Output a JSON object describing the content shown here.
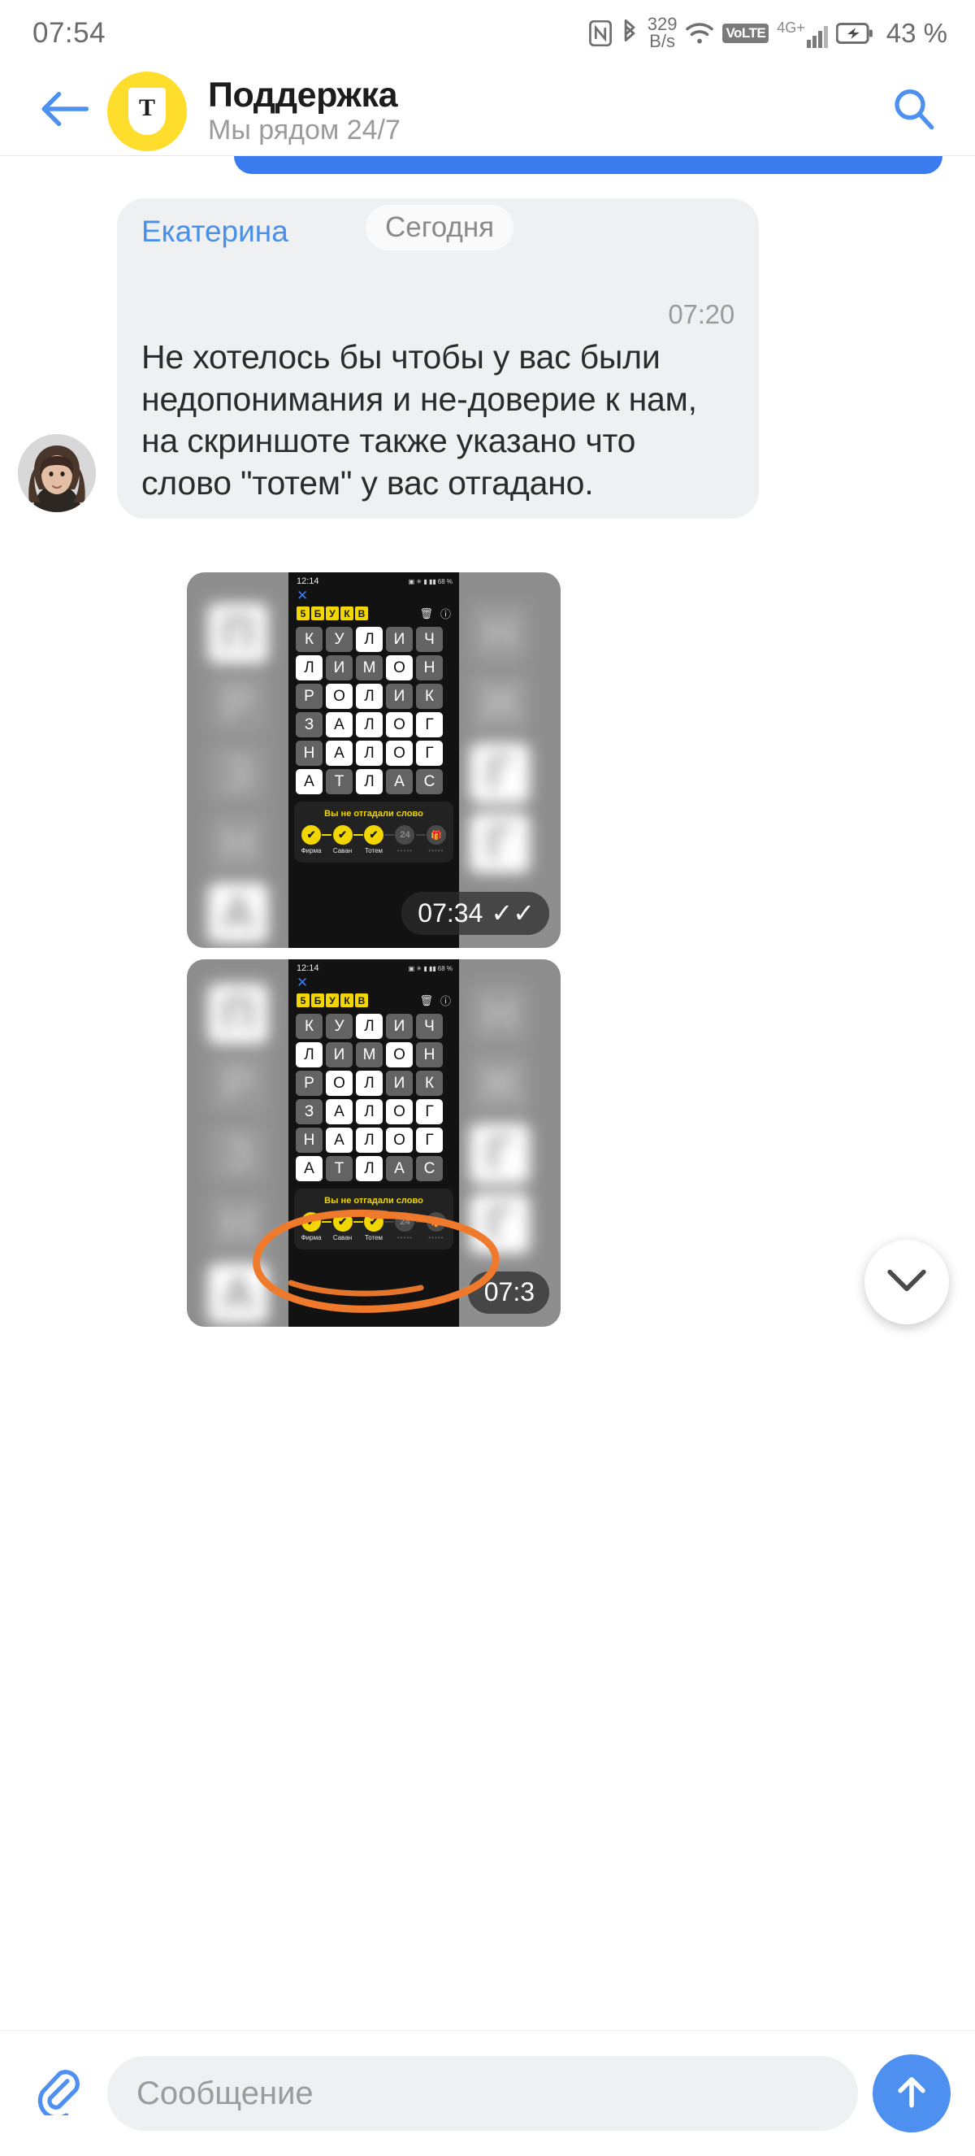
{
  "statusbar": {
    "clock": "07:54",
    "nfc_icon": "nfc-icon",
    "bluetooth_icon": "bluetooth-icon",
    "netspeed_value": "329",
    "netspeed_unit": "B/s",
    "wifi_icon": "wifi-icon",
    "volte_label": "VoLTE",
    "network_label": "4G+",
    "battery_icon": "battery-charging-icon",
    "battery_percent": "43 %"
  },
  "header": {
    "back_icon": "back-arrow-icon",
    "brand_letter": "T",
    "title": "Поддержка",
    "subtitle": "Мы рядом 24/7",
    "search_icon": "search-icon"
  },
  "chat": {
    "date_chip": "Сегодня",
    "message": {
      "sender": "Екатерина",
      "text": "Не хотелось бы чтобы у вас были недопонимания и не-доверие к нам, на скриншоте также указано что слово \"тотем\" у вас отгадано.",
      "time": "07:20"
    },
    "attachments": [
      {
        "time": "07:34",
        "read_receipt": "✓✓"
      },
      {
        "time": "07:3",
        "read_receipt": ""
      }
    ],
    "scroll_down_icon": "chevron-down-icon"
  },
  "game_screenshot": {
    "status_time": "12:14",
    "status_battery": "68 %",
    "close_icon": "close-icon",
    "logo_letters": [
      "5",
      "Б",
      "У",
      "К",
      "В"
    ],
    "trash_icon": "trash-icon",
    "info_icon": "info-icon",
    "grid": [
      {
        "letters": [
          "К",
          "У",
          "Л",
          "И",
          "Ч"
        ],
        "states": [
          "off",
          "off",
          "on",
          "off",
          "off"
        ]
      },
      {
        "letters": [
          "Л",
          "И",
          "М",
          "О",
          "Н"
        ],
        "states": [
          "on",
          "off",
          "off",
          "on",
          "off"
        ]
      },
      {
        "letters": [
          "Р",
          "О",
          "Л",
          "И",
          "К"
        ],
        "states": [
          "off",
          "on",
          "on",
          "off",
          "off"
        ]
      },
      {
        "letters": [
          "З",
          "А",
          "Л",
          "О",
          "Г"
        ],
        "states": [
          "off",
          "on",
          "on",
          "on",
          "on"
        ]
      },
      {
        "letters": [
          "Н",
          "А",
          "Л",
          "О",
          "Г"
        ],
        "states": [
          "off",
          "on",
          "on",
          "on",
          "on"
        ]
      },
      {
        "letters": [
          "А",
          "Т",
          "Л",
          "А",
          "С"
        ],
        "states": [
          "on",
          "off",
          "on",
          "off",
          "off"
        ]
      }
    ],
    "footer_title": "Вы не отгадали слово",
    "progress": [
      {
        "label": "Фирма",
        "mark": "✔",
        "done": true
      },
      {
        "label": "Саван",
        "mark": "✔",
        "done": true
      },
      {
        "label": "Тотем",
        "mark": "✔",
        "done": true
      },
      {
        "label": "•••••",
        "mark": "24",
        "done": false
      },
      {
        "label": "•••••",
        "mark": "gift",
        "done": false
      }
    ]
  },
  "composer": {
    "attach_icon": "paperclip-icon",
    "placeholder": "Сообщение",
    "send_icon": "send-arrow-up-icon"
  },
  "colors": {
    "brand_yellow": "#FFDD2D",
    "accent_blue": "#3a7cf0",
    "bubble_gray": "#eef0f1",
    "game_yellow": "#F2D600",
    "annotation_orange": "#F07A2B"
  }
}
